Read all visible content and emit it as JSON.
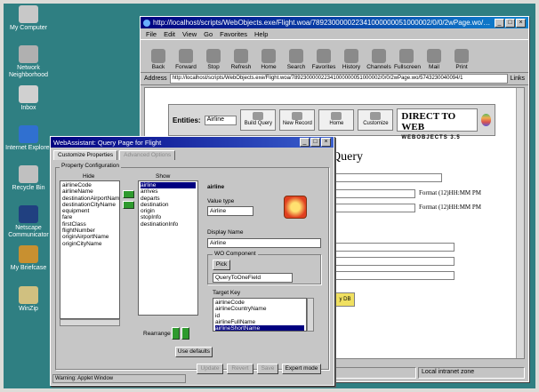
{
  "desktop": {
    "icons": [
      {
        "label": "My Computer",
        "icon": "computer-icon",
        "color": "#c8c8c8"
      },
      {
        "label": "Network Neighborhood",
        "icon": "network-icon",
        "color": "#b0b0b0"
      },
      {
        "label": "Inbox",
        "icon": "inbox-icon",
        "color": "#d0d0d0"
      },
      {
        "label": "Internet Explorer",
        "icon": "ie-icon",
        "color": "#3070d0"
      },
      {
        "label": "Recycle Bin",
        "icon": "recycle-bin-icon",
        "color": "#c0c0c0"
      },
      {
        "label": "Netscape Communicator",
        "icon": "netscape-icon",
        "color": "#204080"
      },
      {
        "label": "My Briefcase",
        "icon": "briefcase-icon",
        "color": "#c89030"
      },
      {
        "label": "WinZip",
        "icon": "winzip-icon",
        "color": "#d0c080"
      }
    ]
  },
  "browser": {
    "title": "http://localhost/scripts/WebObjects.exe/Flight.woa/789230000022341000000051000002/0/0/2wPage.wo/5743230040094",
    "menu": [
      "File",
      "Edit",
      "View",
      "Go",
      "Favorites",
      "Help"
    ],
    "toolbar": [
      "Back",
      "Forward",
      "Stop",
      "Refresh",
      "Home",
      "Search",
      "Favorites",
      "History",
      "Channels",
      "Fullscreen",
      "Mail",
      "Print"
    ],
    "address_label": "Address",
    "address_value": "http://localhost/scripts/WebObjects.exe/Flight.woa/789230000022341000000051000002/0/0/2wPage.wo/5743230040094/1",
    "links_label": "Links",
    "status_zone": "Local intranet zone"
  },
  "page": {
    "entities_label": "Entities:",
    "entity_selected": "Airline",
    "buttons": [
      "Build Query",
      "New Record",
      "Home",
      "Customize"
    ],
    "logo_title": "DIRECT TO WEB",
    "logo_subtitle": "WEBOBJECTS 3.5",
    "query_title": "Query",
    "format_hint": "Format (12)HH:MM PM",
    "db_button": "y DB"
  },
  "dialog": {
    "title": "WebAssistant: Query Page for Flight",
    "tabs": [
      "Customize Properties",
      "Advanced Options"
    ],
    "properties_group": "Property Configuration",
    "hide_label": "Hide",
    "show_label": "Show",
    "hide_items": [
      "airlineCode",
      "airlineName",
      "destinationAirportNam",
      "destinationCityName",
      "equipment",
      "fare",
      "firstClass",
      "flightNumber",
      "originAirportName",
      "originCityName"
    ],
    "show_items": [
      "airline",
      "arrives",
      "departs",
      "destination",
      "origin",
      "stopInfo",
      "destinationInfo"
    ],
    "selected_show_index": 0,
    "rearrange_label": "Rearrange",
    "use_defaults": "Use defaults",
    "prop_name": "airline",
    "value_type_label": "Value type",
    "value_type": "Airline",
    "display_name_label": "Display Name",
    "display_name": "Airline",
    "wo_component_label": "WO Component",
    "pick_button": "Pick",
    "component_value": "QueryToOneField",
    "target_key_label": "Target Key",
    "target_keys": [
      "airlineCode",
      "airlineCountryName",
      "id",
      "airlineFullName",
      "airlineShortName"
    ],
    "selected_key_index": 4,
    "footer_buttons": [
      {
        "label": "Update",
        "disabled": true
      },
      {
        "label": "Revert",
        "disabled": true
      },
      {
        "label": "Save",
        "disabled": true
      },
      {
        "label": "Expert mode",
        "disabled": false
      }
    ],
    "applet_warning": "Warning: Applet Window",
    "accent_color": "#000080"
  }
}
